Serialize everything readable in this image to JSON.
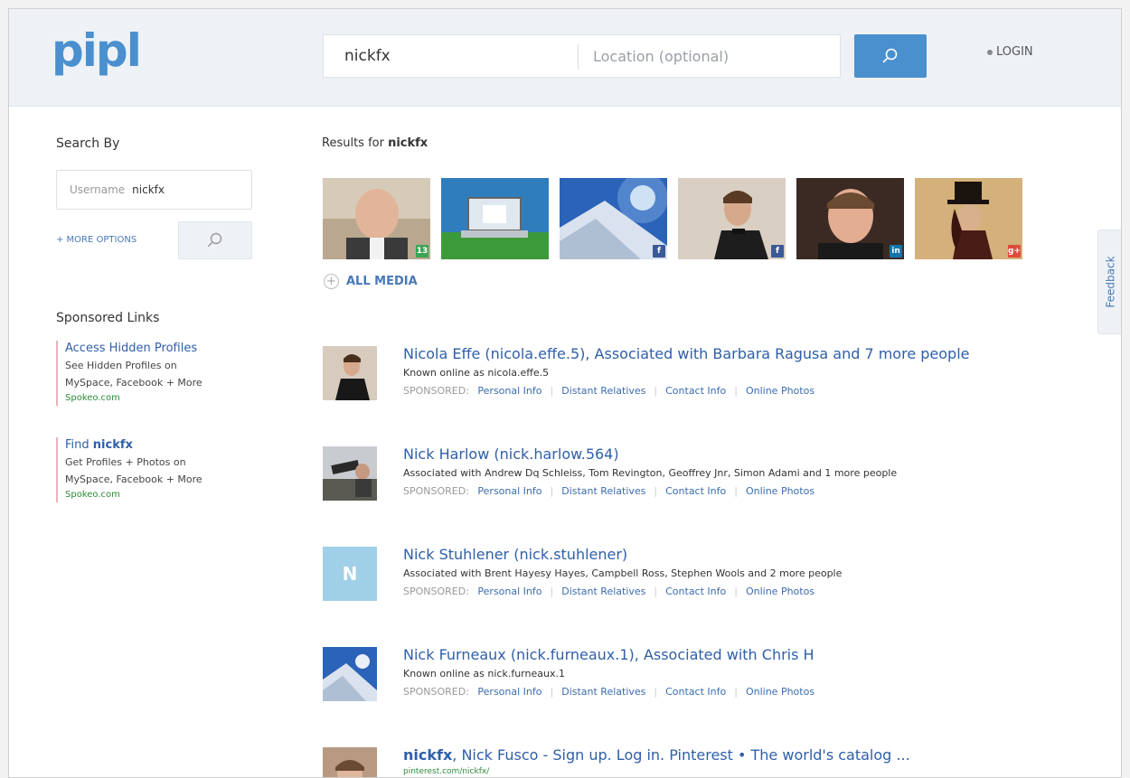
{
  "header": {
    "logo": "pipl",
    "search_value": "nickfx",
    "location_placeholder": "Location (optional)",
    "search_button_icon": "search-icon",
    "login_label": "LOGIN"
  },
  "sidebar": {
    "search_by_title": "Search By",
    "username_label": "Username",
    "username_value": "nickfx",
    "more_options": "+ MORE OPTIONS",
    "sponsored_title": "Sponsored Links",
    "ads": [
      {
        "title": "Access Hidden Profiles",
        "text_line1": "See Hidden Profiles on",
        "text_line2": "MySpace, Facebook + More",
        "url": "Spokeo.com"
      },
      {
        "title_prefix": "Find ",
        "title_bold": "nickfx",
        "text_line1": "Get Profiles + Photos on",
        "text_line2": "MySpace, Facebook + More",
        "url": "Spokeo.com"
      }
    ]
  },
  "main": {
    "results_prefix": "Results for ",
    "results_query": "nickfx",
    "thumbnails": [
      {
        "source": "13"
      },
      {
        "source": ""
      },
      {
        "source": "f"
      },
      {
        "source": "f"
      },
      {
        "source": "in"
      },
      {
        "source": "g+"
      }
    ],
    "all_media": "ALL MEDIA",
    "sponsored_label": "SPONSORED:",
    "sponsored_links": [
      "Personal Info",
      "Distant Relatives",
      "Contact Info",
      "Online Photos"
    ],
    "results": [
      {
        "title": "Nicola Effe (nicola.effe.5), Associated with Barbara Ragusa and 7 more people",
        "subtitle": "Known online as nicola.effe.5"
      },
      {
        "title": "Nick Harlow (nick.harlow.564)",
        "subtitle": "Associated with Andrew Dq Schleiss, Tom Revington, Geoffrey Jnr, Simon Adami and 1 more people"
      },
      {
        "title": "Nick Stuhlener (nick.stuhlener)",
        "subtitle": "Associated with Brent Hayesy Hayes, Campbell Ross, Stephen Wools and 2 more people",
        "initial": "N"
      },
      {
        "title": "Nick Furneaux (nick.furneaux.1), Associated with Chris H",
        "subtitle": "Known online as nick.furneaux.1"
      },
      {
        "title_bold": "nickfx",
        "title_rest": ", Nick Fusco - Sign up. Log in. Pinterest • The world's catalog ...",
        "url": "pinterest.com/nickfx/"
      }
    ]
  },
  "feedback_label": "Feedback",
  "colors": {
    "brand": "#4a90cf",
    "link": "#2f5fa8",
    "ad_url": "#2e8b3a"
  }
}
